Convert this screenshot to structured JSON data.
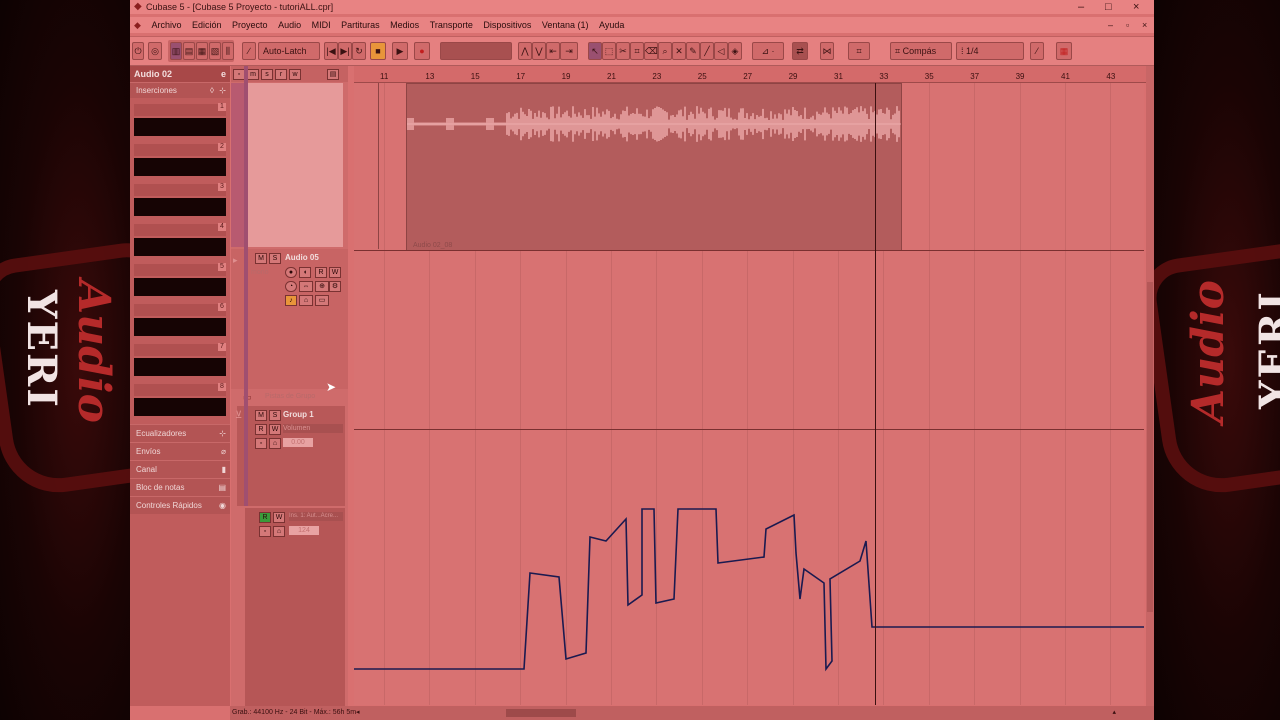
{
  "window": {
    "title": "Cubase 5 - [Cubase 5 Proyecto - tutoriALL.cpr]",
    "buttons": {
      "minimize": "–",
      "maximize": "□",
      "close": "×"
    }
  },
  "menu": {
    "items": [
      "Archivo",
      "Edición",
      "Proyecto",
      "Audio",
      "MIDI",
      "Partituras",
      "Medios",
      "Transporte",
      "Dispositivos",
      "Ventana (1)",
      "Ayuda"
    ]
  },
  "toolbar": {
    "automation_mode": "Auto-Latch",
    "snap_type": "Compás",
    "quantize": "1/4"
  },
  "inspector": {
    "track_name": "Audio 02",
    "sections": {
      "inserts": "Inserciones",
      "eq": "Ecualizadores",
      "sends": "Envíos",
      "channel": "Canal",
      "notepad": "Bloc de notas",
      "quick_controls": "Controles Rápidos"
    },
    "insert_slots": [
      "1",
      "2",
      "3",
      "4",
      "5",
      "6",
      "7",
      "8"
    ]
  },
  "tracks": {
    "track2": {
      "name": "Audio 05",
      "input": "mono"
    },
    "folder": {
      "name": "Pistas de Grupo"
    },
    "group": {
      "name": "Group 1",
      "param": "Volumen",
      "value": "0.00"
    },
    "automation": {
      "name": "Ins. 1: Aut...Acre...",
      "value": "124"
    }
  },
  "ruler": {
    "ticks": [
      "11",
      "13",
      "15",
      "17",
      "19",
      "21",
      "23",
      "25",
      "27",
      "29",
      "31",
      "33",
      "35",
      "37",
      "39",
      "41",
      "43"
    ]
  },
  "event": {
    "label": "Audio 02_08"
  },
  "status": {
    "text": "Grab.: 44100 Hz - 24 Bit - Máx.: 56h 5m"
  },
  "branding": {
    "left_word": "YERI",
    "script": "Audio"
  },
  "colors": {
    "accent": "#e8953a",
    "record": "#c21e1e",
    "automation_line": "#1a1a50"
  }
}
